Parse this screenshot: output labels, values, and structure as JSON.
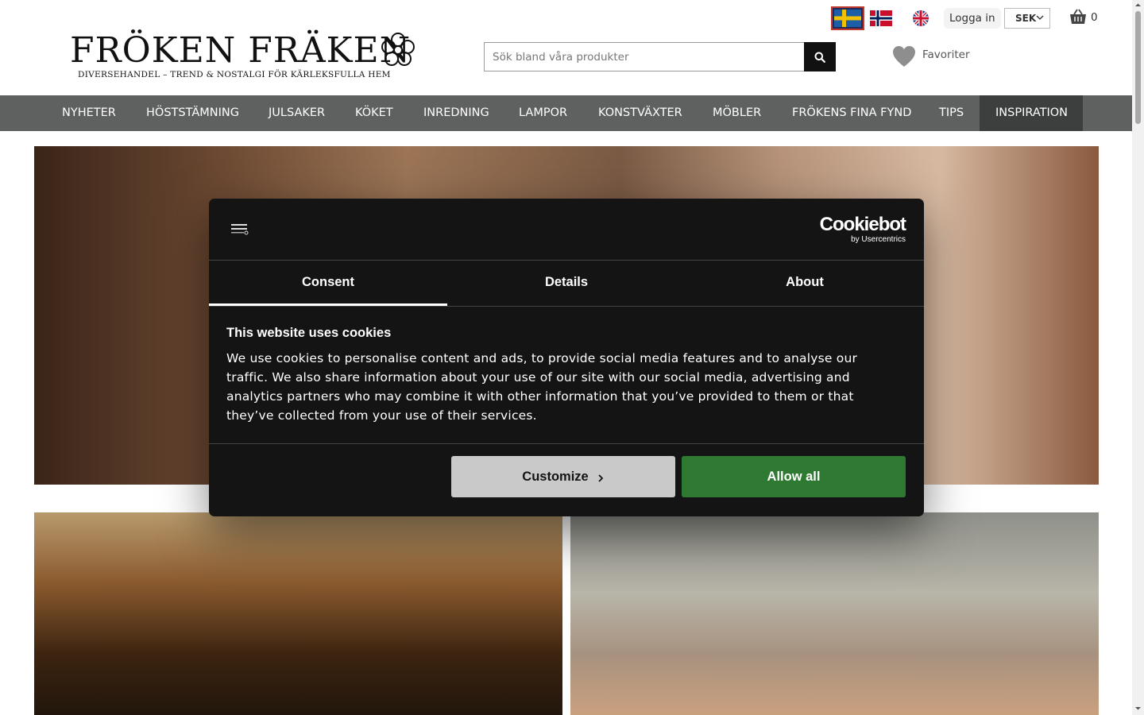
{
  "header": {
    "logo_title": "FRÖKEN FRÄKEN",
    "logo_tagline": "Diversehandel – Trend & nostalgi för kärleksfulla hem",
    "search_placeholder": "Sök bland våra produkter",
    "login_label": "Logga in",
    "currency": "SEK",
    "cart_count": "0",
    "favorites_label": "Favoriter",
    "languages": [
      "swedish-flag",
      "norwegian-flag",
      "english-flag"
    ]
  },
  "nav": {
    "items": [
      {
        "label": "NYHETER"
      },
      {
        "label": "HÖSTSTÄMNING"
      },
      {
        "label": "JULSAKER"
      },
      {
        "label": "KÖKET"
      },
      {
        "label": "INREDNING"
      },
      {
        "label": "LAMPOR"
      },
      {
        "label": "KONSTVÄXTER"
      },
      {
        "label": "MÖBLER"
      },
      {
        "label": "FRÖKENS FINA FYND"
      },
      {
        "label": "TIPS"
      },
      {
        "label": "INSPIRATION"
      }
    ],
    "active": "INSPIRATION"
  },
  "cookie_dialog": {
    "brand": "Cookiebot",
    "brand_sub": "by Usercentrics",
    "tabs": [
      "Consent",
      "Details",
      "About"
    ],
    "active_tab": "Consent",
    "heading": "This website uses cookies",
    "body": "We use cookies to personalise content and ads, to provide social media features and to analyse our traffic. We also share information about your use of our site with our social media, advertising and analytics partners who may combine it with other information that you’ve provided to them or that they’ve collected from your use of their services.",
    "customize_label": "Customize",
    "allow_all_label": "Allow all"
  },
  "colors": {
    "nav_bg": "#5f6060",
    "nav_active": "#3d3e3e",
    "dialog_bg": "#141414",
    "allow_green": "#2f7a33",
    "customize_gray": "#c9c9c9"
  }
}
